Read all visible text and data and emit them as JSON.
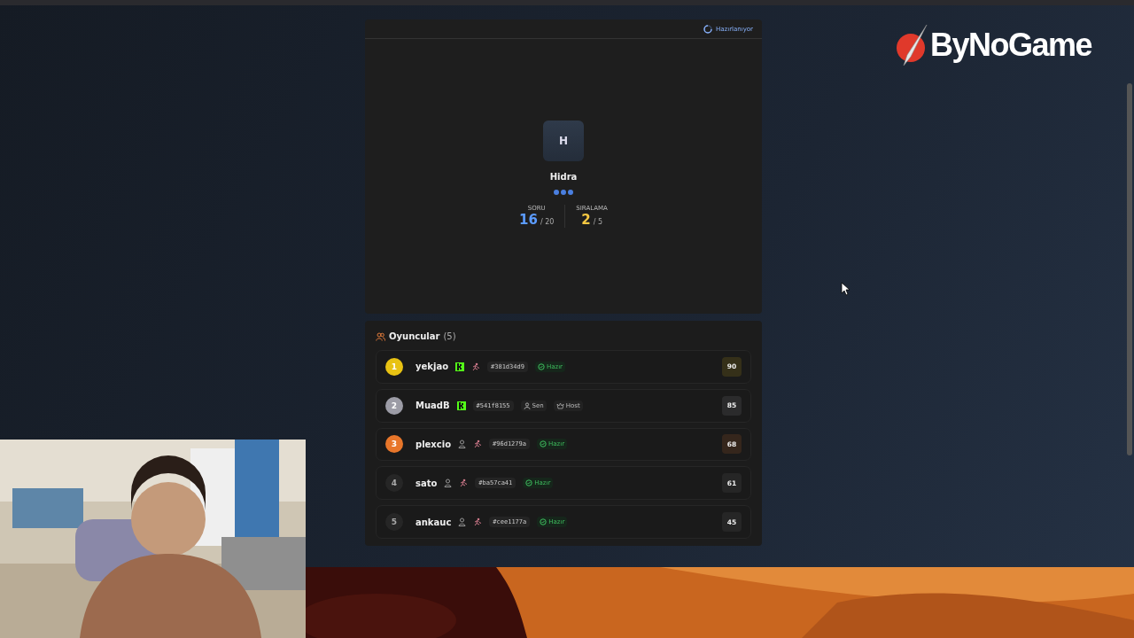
{
  "logo": {
    "text": "ByNoGame"
  },
  "game_card": {
    "status": "Hazırlanıyor",
    "avatar_letter": "H",
    "player_name": "Hidra",
    "stats": [
      {
        "label": "SORU",
        "value": "16",
        "total": "/ 20",
        "kind": "question"
      },
      {
        "label": "SIRALAMA",
        "value": "2",
        "total": "/ 5",
        "kind": "rank"
      }
    ]
  },
  "players_panel": {
    "title": "Oyuncular",
    "count": "(5)",
    "players": [
      {
        "rank": "1",
        "color": "#e8c213",
        "name": "yekjao",
        "kick": true,
        "person": false,
        "runner": true,
        "id": "#381d34d9",
        "tags": [
          {
            "kind": "ready",
            "label": "Hazır"
          }
        ],
        "score": "90"
      },
      {
        "rank": "2",
        "color": "#9c9ca6",
        "name": "MuadB",
        "kick": true,
        "person": false,
        "runner": false,
        "id": "#541f8155",
        "tags": [
          {
            "kind": "you",
            "label": "Sen"
          },
          {
            "kind": "host",
            "label": "Host"
          }
        ],
        "score": "85"
      },
      {
        "rank": "3",
        "color": "#e8762a",
        "name": "plexcio",
        "kick": false,
        "person": true,
        "runner": true,
        "id": "#96d1279a",
        "tags": [
          {
            "kind": "ready",
            "label": "Hazır"
          }
        ],
        "score": "68"
      },
      {
        "rank": "4",
        "name": "sato",
        "kick": false,
        "person": true,
        "runner": true,
        "id": "#ba57ca41",
        "tags": [
          {
            "kind": "ready",
            "label": "Hazır"
          }
        ],
        "score": "61"
      },
      {
        "rank": "5",
        "name": "ankauc",
        "kick": false,
        "person": true,
        "runner": true,
        "id": "#cee1177a",
        "tags": [
          {
            "kind": "ready",
            "label": "Hazır"
          }
        ],
        "score": "45"
      }
    ]
  }
}
